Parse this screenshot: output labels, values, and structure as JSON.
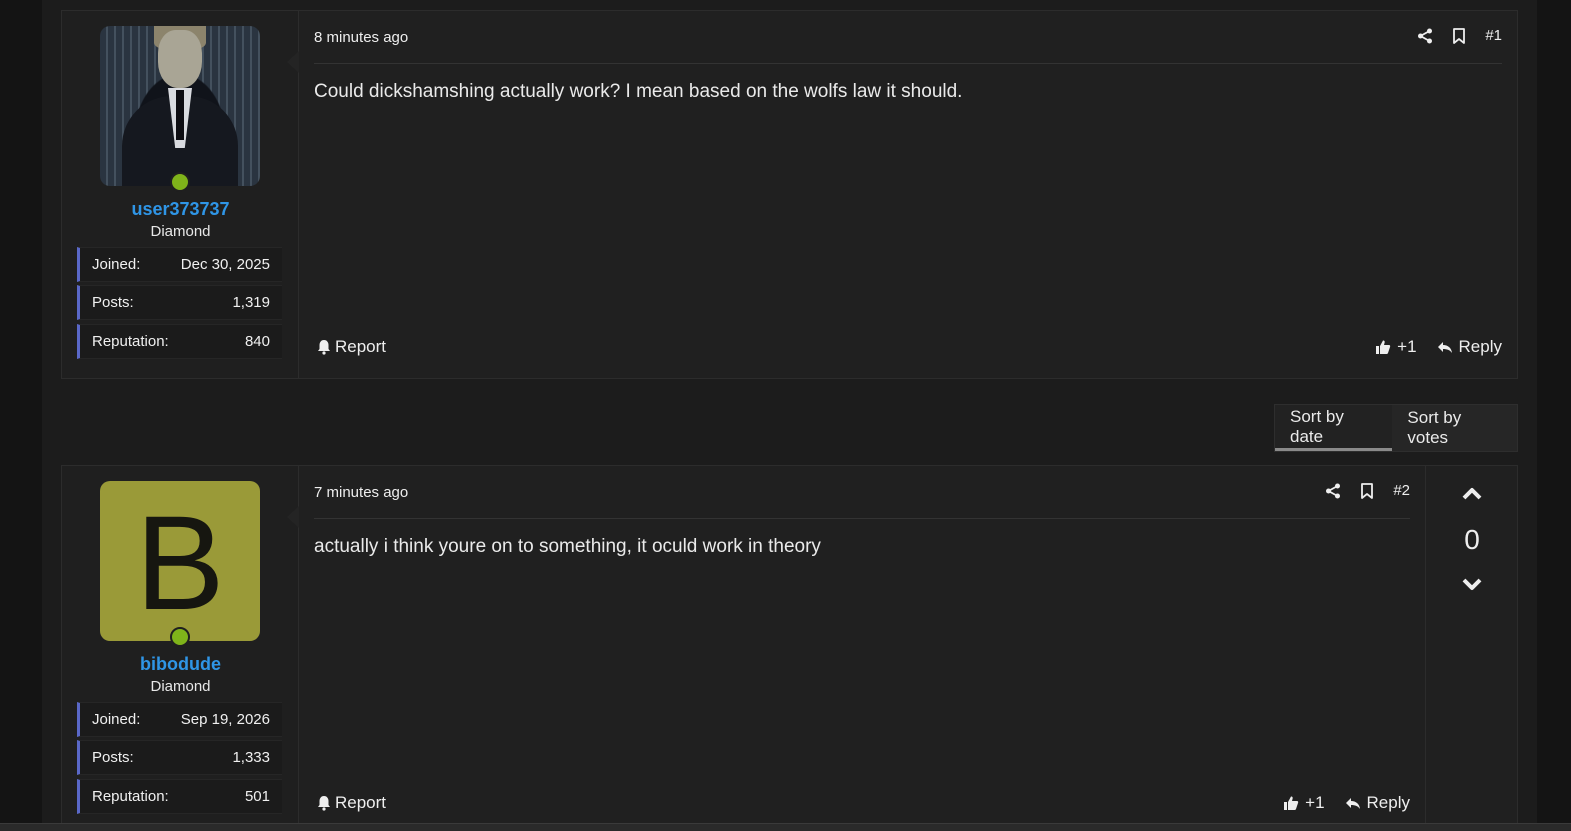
{
  "sort": {
    "by_date": "Sort by date",
    "by_votes": "Sort by votes"
  },
  "posts": [
    {
      "user": {
        "name": "user373737",
        "title": "Diamond",
        "avatar": "photo",
        "stats": [
          {
            "label": "Joined:",
            "value": "Dec 30, 2025"
          },
          {
            "label": "Posts:",
            "value": "1,319"
          },
          {
            "label": "Reputation:",
            "value": "840"
          }
        ]
      },
      "time": "8 minutes ago",
      "number": "#1",
      "message": "Could dickshamshing actually work? I mean based on the wolfs law it should.",
      "report": "Report",
      "likes": "+1",
      "reply": "Reply"
    },
    {
      "user": {
        "name": "bibodude",
        "title": "Diamond",
        "avatar": "B",
        "avatar_color": "#9a9a38",
        "stats": [
          {
            "label": "Joined:",
            "value": "Sep 19, 2026"
          },
          {
            "label": "Posts:",
            "value": "1,333"
          },
          {
            "label": "Reputation:",
            "value": "501"
          }
        ]
      },
      "time": "7 minutes ago",
      "number": "#2",
      "message": "actually i think youre on to something, it oculd work in theory",
      "report": "Report",
      "likes": "+1",
      "reply": "Reply",
      "votes": "0"
    }
  ],
  "colors": {
    "username": "#2f95e6",
    "online": "#7fb31a",
    "stat_accent": "#5a68c8"
  }
}
